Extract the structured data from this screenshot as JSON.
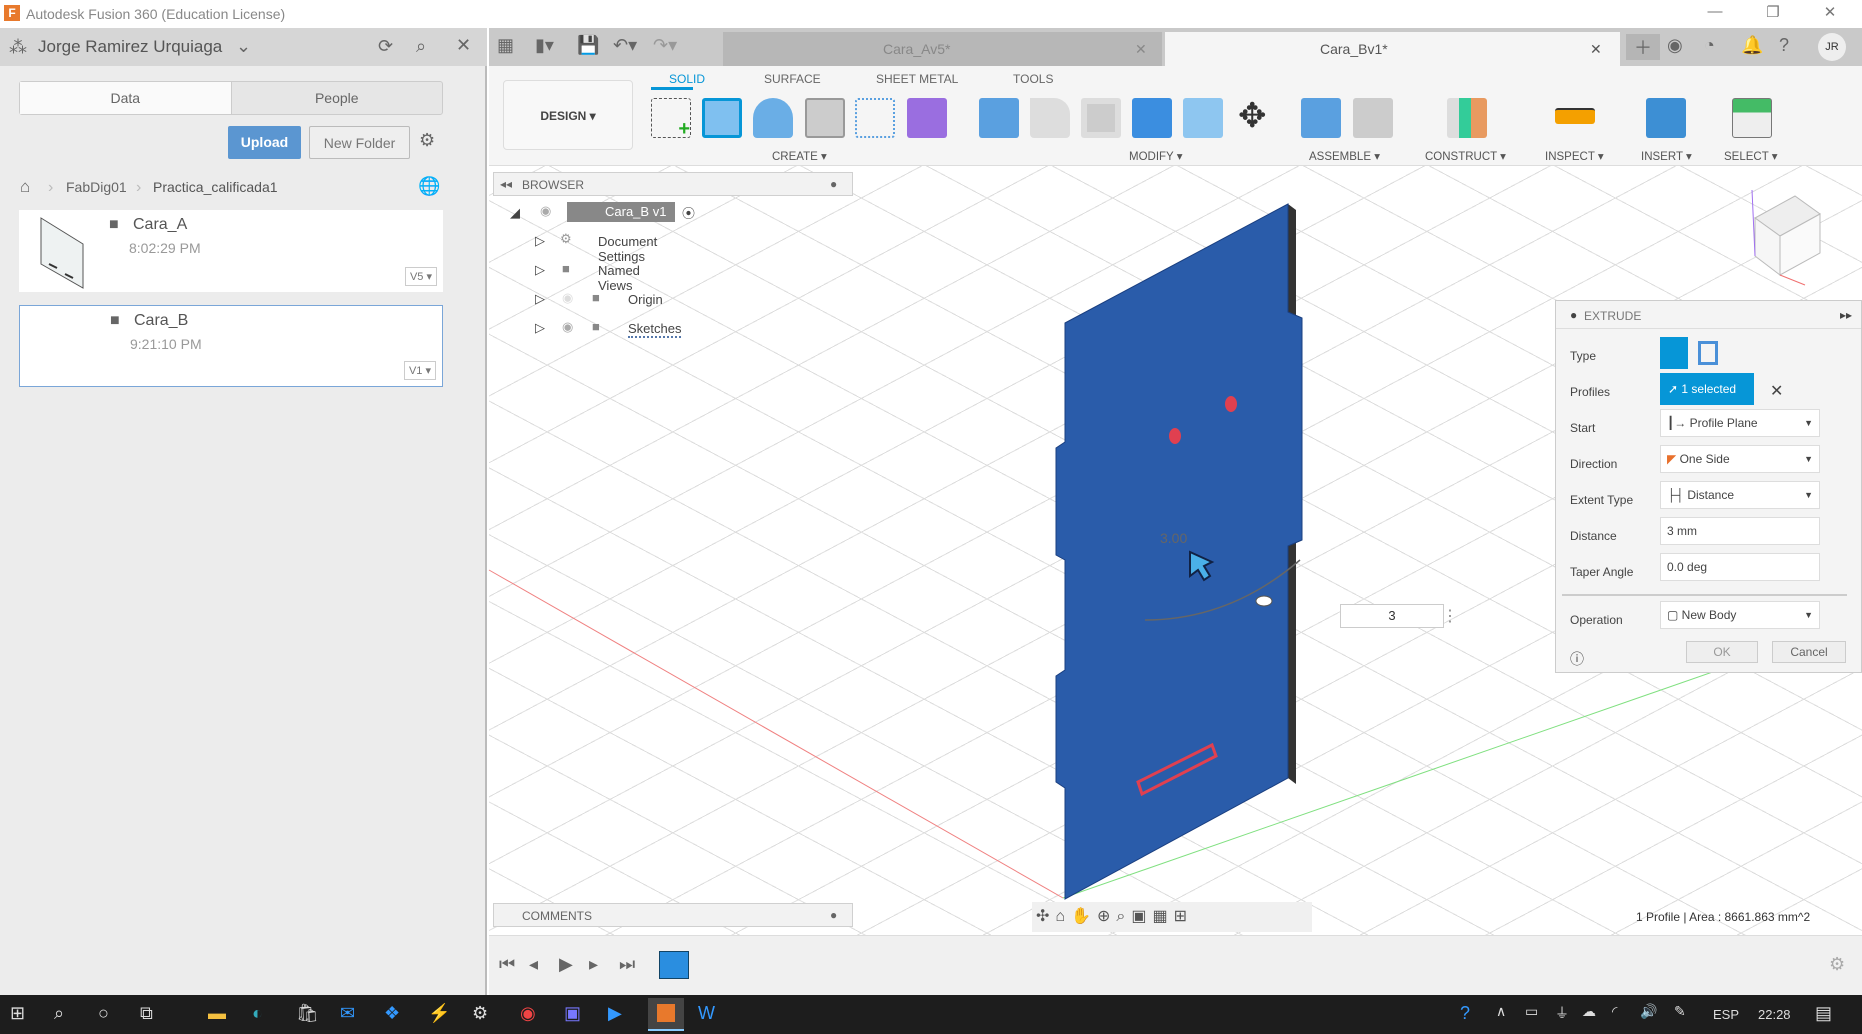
{
  "window": {
    "title": "Autodesk Fusion 360 (Education License)",
    "logo": "F"
  },
  "data_panel": {
    "user": "Jorge Ramirez Urquiaga",
    "tabs": [
      "Data",
      "People"
    ],
    "upload": "Upload",
    "new_folder": "New Folder",
    "breadcrumb": [
      "FabDig01",
      "Practica_calificada1"
    ],
    "files": [
      {
        "name": "Cara_A",
        "time": "8:02:29 PM",
        "version": "V5"
      },
      {
        "name": "Cara_B",
        "time": "9:21:10 PM",
        "version": "V1"
      }
    ]
  },
  "doc_tabs": [
    {
      "label": "Cara_Av5*",
      "active": false
    },
    {
      "label": "Cara_Bv1*",
      "active": true
    }
  ],
  "user_initials": "JR",
  "toolbar": {
    "workspace": "DESIGN",
    "tabs": [
      "SOLID",
      "SURFACE",
      "SHEET METAL",
      "TOOLS"
    ],
    "groups": [
      "CREATE",
      "MODIFY",
      "ASSEMBLE",
      "CONSTRUCT",
      "INSPECT",
      "INSERT",
      "SELECT"
    ],
    "accent": "#0696d7"
  },
  "browser": {
    "title": "BROWSER",
    "root": "Cara_B v1",
    "items": [
      "Document Settings",
      "Named Views",
      "Origin",
      "Sketches"
    ]
  },
  "comments": {
    "title": "COMMENTS"
  },
  "viewport": {
    "dimension": "3.00",
    "distance_input": "3",
    "status": "1 Profile | Area : 8661.863 mm^2",
    "body_color": "#2a5caa"
  },
  "extrude": {
    "title": "EXTRUDE",
    "rows": [
      {
        "label": "Type"
      },
      {
        "label": "Profiles",
        "value": "1 selected"
      },
      {
        "label": "Start",
        "value": "Profile Plane"
      },
      {
        "label": "Direction",
        "value": "One Side"
      },
      {
        "label": "Extent Type",
        "value": "Distance"
      },
      {
        "label": "Distance",
        "value": "3 mm"
      },
      {
        "label": "Taper Angle",
        "value": "0.0 deg"
      },
      {
        "label": "Operation",
        "value": "New Body"
      }
    ],
    "ok": "OK",
    "cancel": "Cancel"
  },
  "taskbar": {
    "lang": "ESP",
    "time": "22:28"
  }
}
